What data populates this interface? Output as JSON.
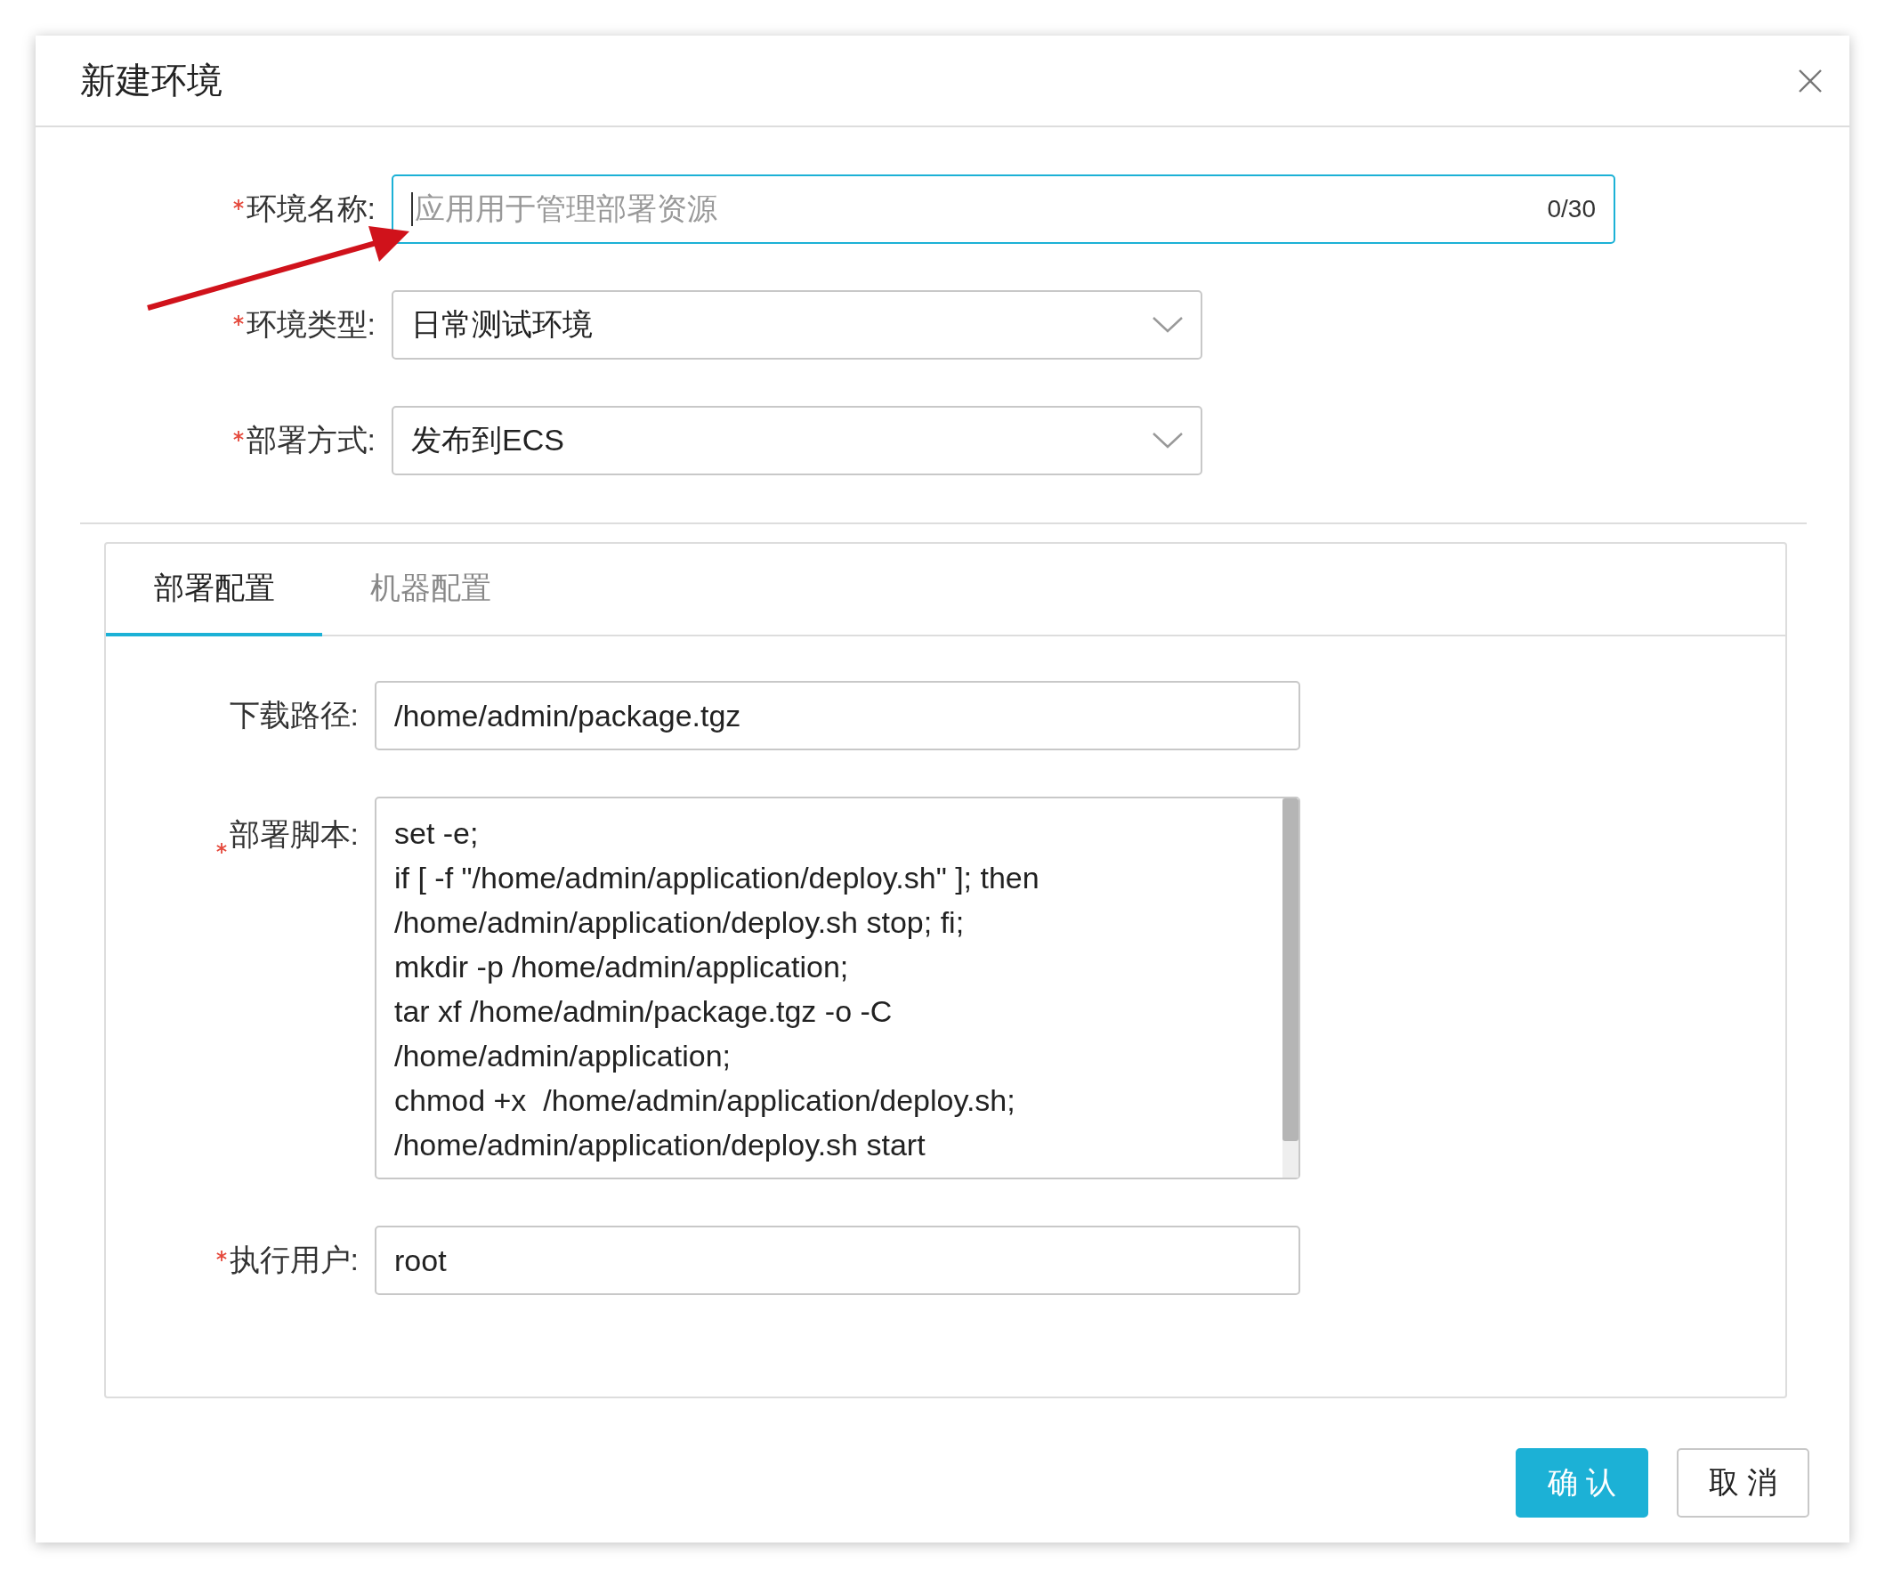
{
  "dialog": {
    "title": "新建环境"
  },
  "form_fields": [
    {
      "kind": "input",
      "label": "环境名称:",
      "required": true,
      "focused": true,
      "placeholder": "应用用于管理部署资源",
      "counter": "0/30"
    },
    {
      "kind": "select",
      "label": "环境类型:",
      "required": true,
      "value": "日常测试环境"
    },
    {
      "kind": "select",
      "label": "部署方式:",
      "required": true,
      "value": "发布到ECS"
    }
  ],
  "tabs": [
    {
      "label": "部署配置",
      "selected": true
    },
    {
      "label": "机器配置",
      "selected": false
    }
  ],
  "tab_fields": [
    {
      "kind": "input",
      "label": "下载路径:",
      "required": false,
      "value": "/home/admin/package.tgz"
    },
    {
      "kind": "textarea",
      "label": "部署脚本:",
      "required": true,
      "value": "set -e;\nif [ -f \"/home/admin/application/deploy.sh\" ]; then\n/home/admin/application/deploy.sh stop; fi;\nmkdir -p /home/admin/application;\ntar xf /home/admin/package.tgz -o -C\n/home/admin/application;\nchmod +x  /home/admin/application/deploy.sh;\n/home/admin/application/deploy.sh start"
    },
    {
      "kind": "input",
      "label": "执行用户:",
      "required": true,
      "value": "root"
    }
  ],
  "buttons": [
    {
      "label": "确 认",
      "primary": true
    },
    {
      "label": "取 消",
      "primary": false
    }
  ]
}
